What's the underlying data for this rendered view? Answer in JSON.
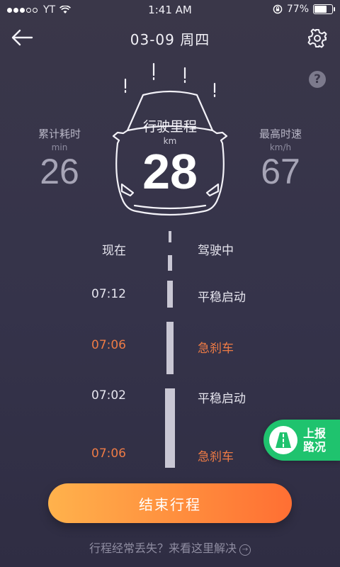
{
  "status_bar": {
    "carrier": "YT",
    "time": "1:41 AM",
    "battery_percent": "77%",
    "battery_level": 0.77,
    "signal_dots_filled": 3,
    "signal_dots_total": 5
  },
  "header": {
    "title": "03-09 周四",
    "back_icon": "back-arrow-icon",
    "settings_icon": "gear-icon",
    "help_icon": "question-icon",
    "help_label": "?"
  },
  "trip": {
    "mileage_label": "行驶里程",
    "mileage_unit": "km",
    "mileage_value": "28",
    "duration_label": "累计耗时",
    "duration_unit": "min",
    "duration_value": "26",
    "max_speed_label": "最高时速",
    "max_speed_unit": "km/h",
    "max_speed_value": "67"
  },
  "timeline": [
    {
      "time": "现在",
      "event": "驾驶中",
      "warn": false
    },
    {
      "time": "07:12",
      "event": "平稳启动",
      "warn": false
    },
    {
      "time": "07:06",
      "event": "急刹车",
      "warn": true
    },
    {
      "time": "07:02",
      "event": "平稳启动",
      "warn": false
    },
    {
      "time": "07:06",
      "event": "急刹车",
      "warn": true
    }
  ],
  "report": {
    "label_line1": "上报",
    "label_line2": "路况",
    "icon": "road-icon"
  },
  "actions": {
    "end_trip": "结束行程",
    "lost_trip": "行程经常丢失？来看这里解决",
    "lost_trip_icon": "arrow-right-circle-icon"
  },
  "colors": {
    "background": "#363449",
    "warn": "#ee7b45",
    "report_green": "#1fc36e",
    "button_orange_start": "#ffb24c",
    "button_orange_end": "#ff6f33"
  }
}
